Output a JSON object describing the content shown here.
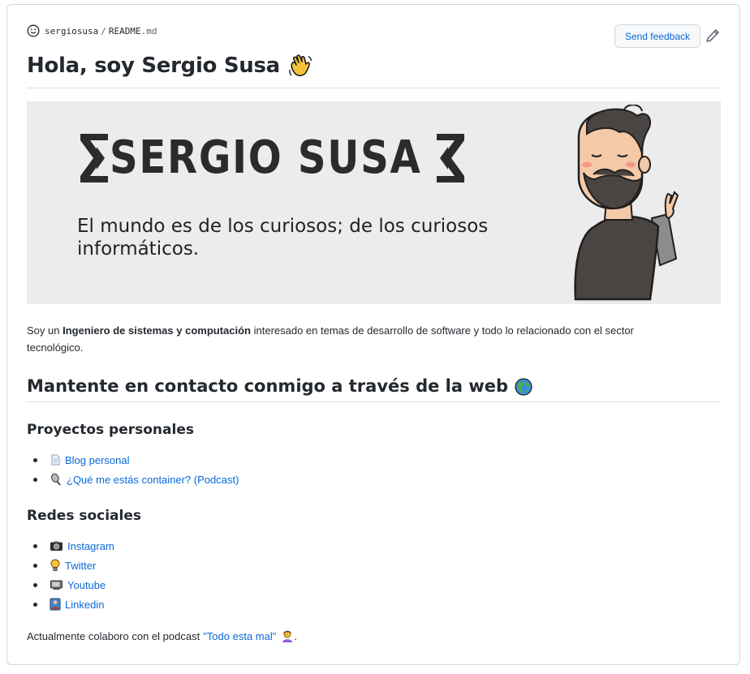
{
  "breadcrumb": {
    "owner": "sergiosusa",
    "separator": "/",
    "file_base": "README",
    "file_ext": ".md"
  },
  "header": {
    "feedback_label": "Send feedback"
  },
  "title": "Hola, soy Sergio Susa",
  "banner": {
    "logo_text": "SERGIO SUSA",
    "tagline": "El mundo es de los curiosos; de los curiosos informáticos."
  },
  "intro": {
    "prefix": "Soy un ",
    "bold": "Ingeniero de sistemas y computación",
    "suffix": " interesado en temas de desarrollo de software y todo lo relacionado con el sector tecnológico."
  },
  "contact_heading": "Mantente en contacto conmigo a través de la web",
  "projects": {
    "heading": "Proyectos personales",
    "items": [
      {
        "label": "Blog personal",
        "icon": "page-icon"
      },
      {
        "label": "¿Qué me estás container? (Podcast)",
        "icon": "microphone-icon"
      }
    ]
  },
  "social": {
    "heading": "Redes sociales",
    "items": [
      {
        "label": "Instagram",
        "icon": "camera-icon"
      },
      {
        "label": "Twitter",
        "icon": "lightbulb-icon"
      },
      {
        "label": "Youtube",
        "icon": "tv-icon"
      },
      {
        "label": "Linkedin",
        "icon": "briefcase-person-icon"
      }
    ]
  },
  "outro": {
    "text": "Actualmente colaboro con el podcast",
    "link": "\"Todo esta mal\"",
    "end": "."
  },
  "colors": {
    "link": "#0969da",
    "border": "#d0d7de",
    "banner_bg": "#ececec"
  }
}
